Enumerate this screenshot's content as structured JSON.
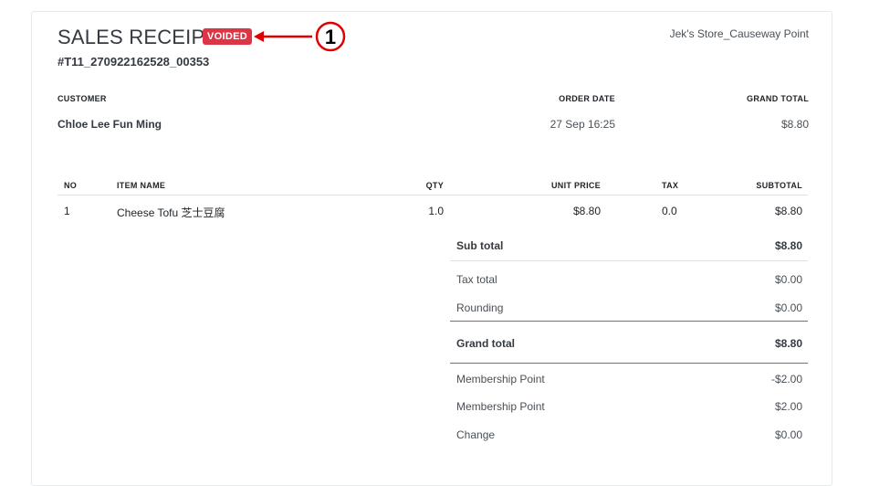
{
  "receipt": {
    "title": "SALES RECEIPT",
    "status_badge": "VOIDED",
    "annotation_number": "1",
    "number": "#T11_270922162528_00353",
    "store": "Jek's Store_Causeway Point"
  },
  "summary": {
    "customer_label": "CUSTOMER",
    "customer_value": "Chloe Lee Fun Ming",
    "order_date_label": "ORDER DATE",
    "order_date_value": "27 Sep 16:25",
    "grand_total_label": "GRAND TOTAL",
    "grand_total_value": "$8.80"
  },
  "items_table": {
    "headers": {
      "no": "NO",
      "item_name": "ITEM NAME",
      "qty": "QTY",
      "unit_price": "UNIT PRICE",
      "tax": "TAX",
      "subtotal": "SUBTOTAL"
    },
    "rows": [
      {
        "no": "1",
        "item_name": "Cheese Tofu 芝士豆腐",
        "qty": "1.0",
        "unit_price": "$8.80",
        "tax": "0.0",
        "subtotal": "$8.80"
      }
    ]
  },
  "totals": [
    {
      "label": "Sub total",
      "value": "$8.80"
    },
    {
      "label": "Tax total",
      "value": "$0.00"
    },
    {
      "label": "Rounding",
      "value": "$0.00"
    },
    {
      "label": "Grand total",
      "value": "$8.80"
    },
    {
      "label": "Membership Point",
      "value": "-$2.00"
    },
    {
      "label": "Membership Point",
      "value": "$2.00"
    },
    {
      "label": "Change",
      "value": "$0.00"
    }
  ],
  "colors": {
    "badge": "#dc3545",
    "annotation": "#e00000"
  }
}
